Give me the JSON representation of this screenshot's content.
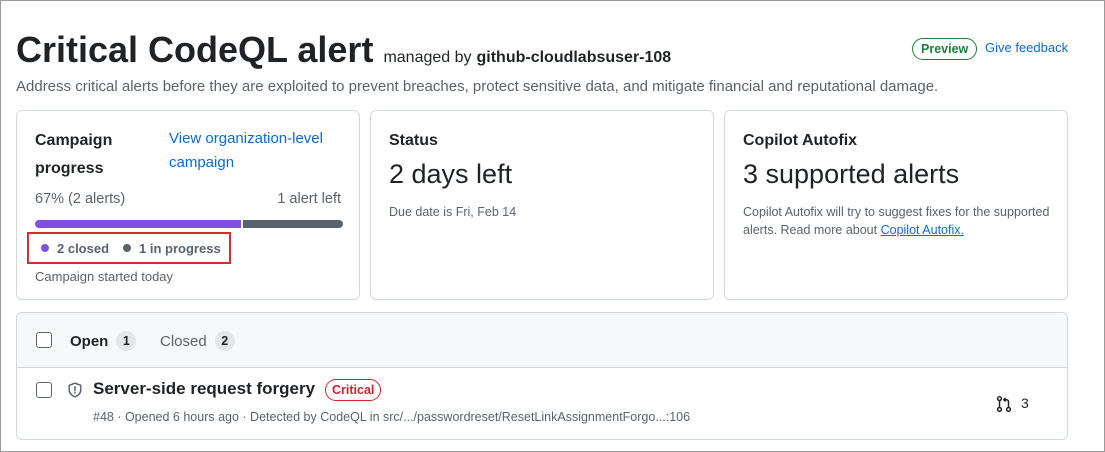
{
  "header": {
    "title": "Critical CodeQL alert",
    "managed_by_label": "managed by",
    "owner": "github-cloudlabsuser-108",
    "preview_badge": "Preview",
    "feedback_link": "Give feedback",
    "description": "Address critical alerts before they are exploited to prevent breaches, protect sensitive data, and mitigate financial and reputational damage."
  },
  "progress_card": {
    "title": "Campaign progress",
    "org_link": "View organization-level campaign",
    "percent_text": "67% (2 alerts)",
    "remaining_text": "1 alert left",
    "closed_fraction": 0.67,
    "legend": {
      "closed": "2 closed",
      "in_progress": "1 in progress"
    },
    "started_text": "Campaign started today"
  },
  "status_card": {
    "title": "Status",
    "value": "2 days left",
    "detail": "Due date is Fri, Feb 14"
  },
  "autofix_card": {
    "title": "Copilot Autofix",
    "value": "3 supported alerts",
    "detail_prefix": "Copilot Autofix will try to suggest fixes for the supported alerts. Read more about",
    "detail_link": "Copilot Autofix."
  },
  "alerts_list": {
    "tabs": [
      {
        "label": "Open",
        "count": "1"
      },
      {
        "label": "Closed",
        "count": "2"
      }
    ],
    "rows": [
      {
        "title": "Server-side request forgery",
        "severity": "Critical",
        "meta": "#48 · Opened 6 hours ago · Detected by CodeQL in src/.../passwordreset/ResetLinkAssignmentForgo...:106",
        "linked_prs": "3"
      }
    ]
  },
  "colors": {
    "accent": "#0969da",
    "closed": "#8250df",
    "in_progress": "#59636e",
    "critical": "#cf222e",
    "preview": "#1a7f37",
    "highlight_box": "#d32f2f"
  },
  "icons": {
    "row_severity": "shield-icon",
    "row_linked": "git-pull-request-icon"
  }
}
